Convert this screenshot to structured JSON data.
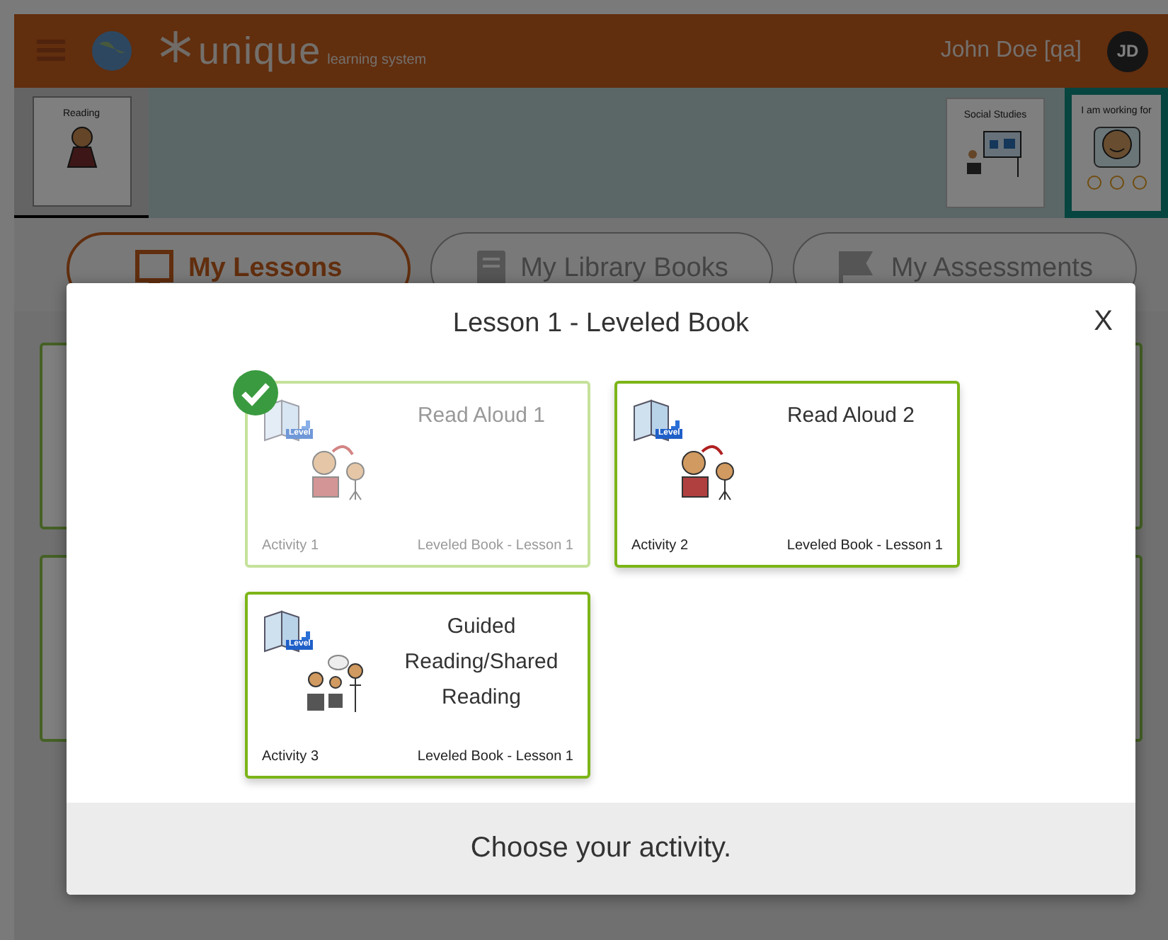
{
  "header": {
    "brand": "unique",
    "brand_tagline": "learning system",
    "user_name": "John Doe [qa]",
    "avatar_initials": "JD"
  },
  "subject_tiles": [
    {
      "label": "Reading",
      "kind": "subject",
      "selected": true
    },
    {
      "label": "Social Studies",
      "kind": "subject",
      "selected": false
    },
    {
      "label": "I am working for",
      "kind": "token_board",
      "selected": false
    }
  ],
  "nav_tabs": [
    {
      "label": "My Lessons",
      "kind": "lessons",
      "selected": true
    },
    {
      "label": "My Library Books",
      "kind": "library",
      "selected": false
    },
    {
      "label": "My Assessments",
      "kind": "assessments",
      "selected": false
    }
  ],
  "modal": {
    "title": "Lesson 1 - Leveled Book",
    "close": "X",
    "activities": [
      {
        "title": "Read Aloud 1",
        "kind": "read_aloud",
        "badge": "Level",
        "activity": "Activity 1",
        "lesson": "Leveled Book - Lesson 1",
        "completed": true
      },
      {
        "title": "Read Aloud 2",
        "kind": "read_aloud",
        "badge": "Level",
        "activity": "Activity 2",
        "lesson": "Leveled Book - Lesson 1",
        "completed": false
      },
      {
        "title": "Guided Reading/Shared Reading",
        "kind": "guided",
        "badge": "Level",
        "activity": "Activity 3",
        "lesson": "Leveled Book - Lesson 1",
        "completed": false
      }
    ],
    "footer": "Choose your activity."
  }
}
